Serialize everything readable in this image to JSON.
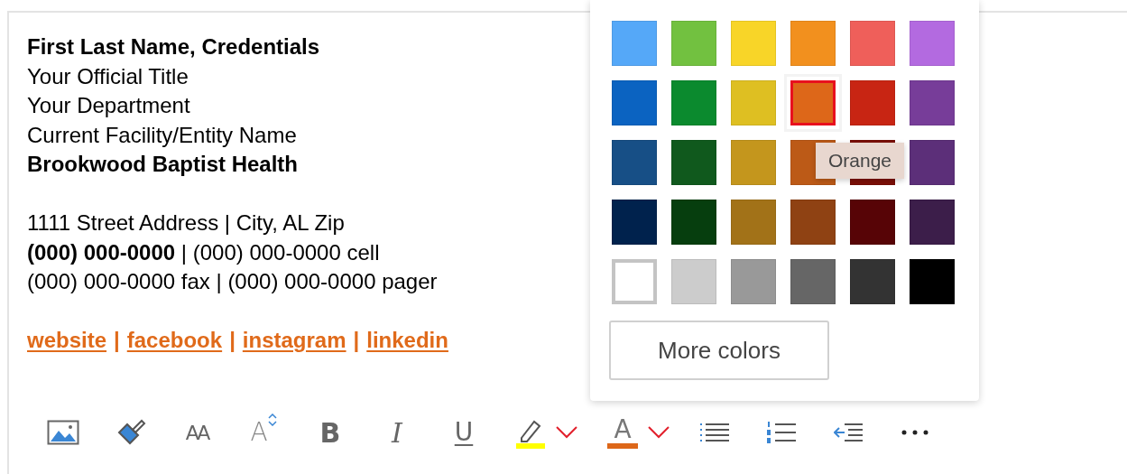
{
  "signature": {
    "name_lines": [
      {
        "text": "First Last Name, Credentials",
        "bold": true
      },
      {
        "text": "Your Official Title",
        "bold": false
      },
      {
        "text": "Your Department",
        "bold": false
      },
      {
        "text": "Current Facility/Entity Name",
        "bold": false
      },
      {
        "text": "Brookwood Baptist Health",
        "bold": true
      }
    ],
    "contact_lines": [
      "1111 Street Address | City, AL Zip",
      "**(000) 000-0000** | (000) 000-0000 cell",
      "(000) 000-0000 fax | (000) 000-0000 pager"
    ],
    "links": [
      "website",
      "facebook",
      "instagram",
      "linkedin"
    ],
    "link_separator": "|"
  },
  "color_picker": {
    "swatches": [
      [
        {
          "color": "#55a8f8",
          "selected": false
        },
        {
          "color": "#72c140",
          "selected": false
        },
        {
          "color": "#f8d528",
          "selected": false
        },
        {
          "color": "#f2901e",
          "selected": false
        },
        {
          "color": "#ef5f5a",
          "selected": false
        },
        {
          "color": "#b36ae0",
          "selected": false
        }
      ],
      [
        {
          "color": "#0b63c1",
          "selected": false
        },
        {
          "color": "#0b8a2e",
          "selected": false
        },
        {
          "color": "#debf22",
          "selected": false
        },
        {
          "color": "#dd6719",
          "selected": true
        },
        {
          "color": "#c82513",
          "selected": false
        },
        {
          "color": "#773d99",
          "selected": false
        }
      ],
      [
        {
          "color": "#174f86",
          "selected": false
        },
        {
          "color": "#10591d",
          "selected": false
        },
        {
          "color": "#c4961d",
          "selected": false
        },
        {
          "color": "#bc5a17",
          "selected": false
        },
        {
          "color": "#7c0f07",
          "selected": false
        },
        {
          "color": "#5c2f79",
          "selected": false
        }
      ],
      [
        {
          "color": "#00224d",
          "selected": false
        },
        {
          "color": "#063e0e",
          "selected": false
        },
        {
          "color": "#a27218",
          "selected": false
        },
        {
          "color": "#8f4213",
          "selected": false
        },
        {
          "color": "#570406",
          "selected": false
        },
        {
          "color": "#3c1e4a",
          "selected": false
        }
      ],
      [
        {
          "color": "#ffffff",
          "selected": false
        },
        {
          "color": "#cccccc",
          "selected": false
        },
        {
          "color": "#999999",
          "selected": false
        },
        {
          "color": "#666666",
          "selected": false
        },
        {
          "color": "#333333",
          "selected": false
        },
        {
          "color": "#000000",
          "selected": false
        }
      ]
    ],
    "tooltip": "Orange",
    "more_button": "More colors"
  },
  "toolbar": [
    {
      "kind": "image"
    },
    {
      "kind": "format-painter"
    },
    {
      "kind": "font-size",
      "glyph": "AA"
    },
    {
      "kind": "grow-font",
      "glyph": "A"
    },
    {
      "kind": "bold",
      "glyph": "B"
    },
    {
      "kind": "italic",
      "glyph": "I"
    },
    {
      "kind": "underline",
      "glyph": "U"
    },
    {
      "kind": "highlight",
      "color": "#ffff00",
      "has_dropdown": true
    },
    {
      "kind": "font-color",
      "glyph": "A",
      "color": "#dd6719",
      "has_dropdown": true
    },
    {
      "kind": "bullets"
    },
    {
      "kind": "numbering"
    },
    {
      "kind": "outdent"
    },
    {
      "kind": "more"
    }
  ]
}
